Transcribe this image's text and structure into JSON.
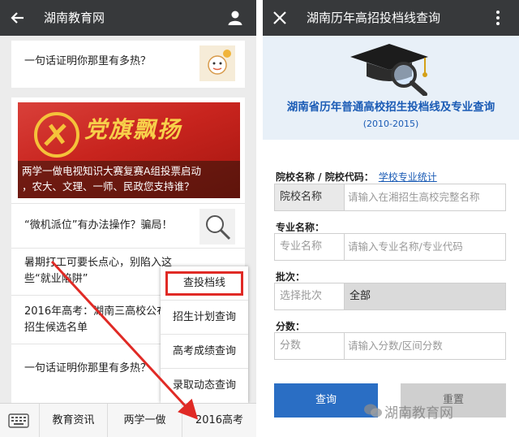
{
  "left": {
    "header": {
      "title": "湖南教育网",
      "back_icon": "arrow-left-icon",
      "profile_icon": "person-icon"
    },
    "top_item": {
      "text": "一句话证明你那里有多热？"
    },
    "banner": {
      "overlay": "党旗飘扬",
      "caption_line1": "两学一做电视知识大赛复赛A组投票启动",
      "caption_line2": "，农大、文理、一师、民政您支持谁？"
    },
    "news": [
      {
        "line1": "“微机派位”有办法操作？骗局！",
        "line2": ""
      },
      {
        "line1": "暑期打工可要长点心，别陷入这",
        "line2": "些“就业陷阱”"
      },
      {
        "line1": "2016年高考：湖南三高校公布",
        "line2": "招生候选名单"
      },
      {
        "line1": "一句话证明你那里有多热？",
        "line2": ""
      }
    ],
    "popup_menu": [
      "查投档线",
      "招生计划查询",
      "高考成绩查询",
      "录取动态查询"
    ],
    "bottom_tabs": [
      "教育资讯",
      "两学一做",
      "2016高考"
    ],
    "keyboard_icon": "keyboard-icon",
    "highlight_color": "#e02a25"
  },
  "right": {
    "header": {
      "title": "湖南历年高招投档线查询",
      "close_icon": "close-icon",
      "more_icon": "more-vertical-icon"
    },
    "hero": {
      "title": "湖南省历年普通高校招生投档线及专业查询",
      "years": "(2010-2015)"
    },
    "school": {
      "label": "院校名称 / 院校代码：",
      "link": "学校专业统计",
      "prefix": "院校名称",
      "placeholder": "请输入在湘招生高校完整名称"
    },
    "major": {
      "label": "专业名称：",
      "prefix": "专业名称",
      "placeholder": "请输入专业名称/专业代码"
    },
    "batch": {
      "label": "批次：",
      "prefix": "选择批次",
      "value": "全部"
    },
    "score": {
      "label": "分数：",
      "prefix": "分数",
      "placeholder": "请输入分数/区间分数"
    },
    "buttons": {
      "query": "查询",
      "reset": "重置"
    },
    "watermark": "湖南教育网",
    "accent": "#2a6ec4"
  }
}
